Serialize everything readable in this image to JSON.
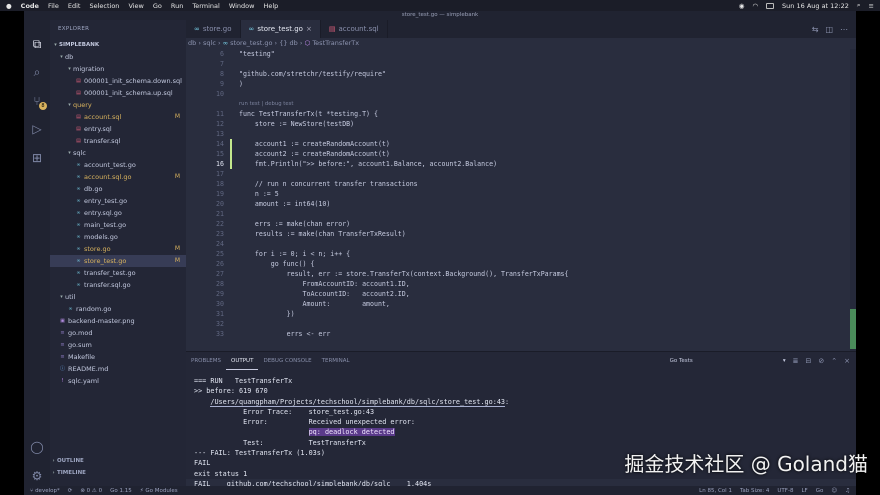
{
  "menubar": {
    "app": "Code",
    "items": [
      "File",
      "Edit",
      "Selection",
      "View",
      "Go",
      "Run",
      "Terminal",
      "Window",
      "Help"
    ],
    "clock": "Sun 16 Aug at 12:22"
  },
  "window": {
    "title": "store_test.go — simplebank"
  },
  "sidebar": {
    "header": "EXPLORER",
    "project": "SIMPLEBANK",
    "tree": [
      {
        "label": "db",
        "kind": "folder",
        "depth": 0,
        "open": true
      },
      {
        "label": "migration",
        "kind": "folder",
        "depth": 1,
        "open": true
      },
      {
        "label": "000001_init_schema.down.sql",
        "kind": "sql",
        "depth": 2
      },
      {
        "label": "000001_init_schema.up.sql",
        "kind": "sql",
        "depth": 2
      },
      {
        "label": "query",
        "kind": "folder",
        "depth": 1,
        "open": true,
        "mod": true
      },
      {
        "label": "account.sql",
        "kind": "sql",
        "depth": 2,
        "mod": true,
        "badge": "M"
      },
      {
        "label": "entry.sql",
        "kind": "sql",
        "depth": 2
      },
      {
        "label": "transfer.sql",
        "kind": "sql",
        "depth": 2
      },
      {
        "label": "sqlc",
        "kind": "folder",
        "depth": 1,
        "open": true
      },
      {
        "label": "account_test.go",
        "kind": "go",
        "depth": 2
      },
      {
        "label": "account.sql.go",
        "kind": "go",
        "depth": 2,
        "mod": true,
        "badge": "M"
      },
      {
        "label": "db.go",
        "kind": "go",
        "depth": 2
      },
      {
        "label": "entry_test.go",
        "kind": "go",
        "depth": 2
      },
      {
        "label": "entry.sql.go",
        "kind": "go",
        "depth": 2
      },
      {
        "label": "main_test.go",
        "kind": "go",
        "depth": 2
      },
      {
        "label": "models.go",
        "kind": "go",
        "depth": 2
      },
      {
        "label": "store.go",
        "kind": "go",
        "depth": 2,
        "mod": true,
        "badge": "M"
      },
      {
        "label": "store_test.go",
        "kind": "go",
        "depth": 2,
        "mod": true,
        "badge": "M",
        "selected": true
      },
      {
        "label": "transfer_test.go",
        "kind": "go",
        "depth": 2
      },
      {
        "label": "transfer.sql.go",
        "kind": "go",
        "depth": 2
      },
      {
        "label": "util",
        "kind": "folder",
        "depth": 0,
        "open": true
      },
      {
        "label": "random.go",
        "kind": "go",
        "depth": 1
      },
      {
        "label": "backend-master.png",
        "kind": "img",
        "depth": 0
      },
      {
        "label": "go.mod",
        "kind": "mod",
        "depth": 0
      },
      {
        "label": "go.sum",
        "kind": "mod",
        "depth": 0
      },
      {
        "label": "Makefile",
        "kind": "mod",
        "depth": 0
      },
      {
        "label": "README.md",
        "kind": "md",
        "depth": 0
      },
      {
        "label": "sqlc.yaml",
        "kind": "yml",
        "depth": 0
      }
    ],
    "outline": "OUTLINE",
    "timeline": "TIMELINE"
  },
  "icons": [
    "files-icon",
    "search-icon",
    "source-control-icon",
    "run-debug-icon",
    "extensions-icon",
    "account-icon",
    "settings-icon"
  ],
  "scm_badge": "8",
  "editor": {
    "tabs": [
      {
        "label": "store.go",
        "active": false
      },
      {
        "label": "store_test.go",
        "active": true
      },
      {
        "label": "account.sql",
        "active": false
      }
    ],
    "breadcrumb": [
      "db",
      "sqlc",
      "store_test.go",
      "{} db",
      "TestTransferTx"
    ],
    "lines": [
      {
        "n": "6",
        "t": "\"testing\""
      },
      {
        "n": "7",
        "t": ""
      },
      {
        "n": "8",
        "t": "\"github.com/stretchr/testify/require\""
      },
      {
        "n": "9",
        "t": ")"
      },
      {
        "n": "10",
        "t": ""
      },
      {
        "n": "",
        "t": "run test | debug test",
        "lens": true
      },
      {
        "n": "11",
        "t": "func TestTransferTx(t *testing.T) {"
      },
      {
        "n": "12",
        "t": "    store := NewStore(testDB)"
      },
      {
        "n": "13",
        "t": ""
      },
      {
        "n": "14",
        "t": "    account1 := createRandomAccount(t)",
        "g": true
      },
      {
        "n": "15",
        "t": "    account2 := createRandomAccount(t)",
        "g": true
      },
      {
        "n": "16",
        "t": "    fmt.Println(\">> before:\", account1.Balance, account2.Balance)",
        "g": true,
        "cur": true
      },
      {
        "n": "17",
        "t": ""
      },
      {
        "n": "18",
        "t": "    // run n concurrent transfer transactions"
      },
      {
        "n": "19",
        "t": "    n := 5"
      },
      {
        "n": "20",
        "t": "    amount := int64(10)"
      },
      {
        "n": "21",
        "t": ""
      },
      {
        "n": "22",
        "t": "    errs := make(chan error)"
      },
      {
        "n": "23",
        "t": "    results := make(chan TransferTxResult)"
      },
      {
        "n": "24",
        "t": ""
      },
      {
        "n": "25",
        "t": "    for i := 0; i < n; i++ {"
      },
      {
        "n": "26",
        "t": "        go func() {"
      },
      {
        "n": "27",
        "t": "            result, err := store.TransferTx(context.Background(), TransferTxParams{"
      },
      {
        "n": "28",
        "t": "                FromAccountID: account1.ID,"
      },
      {
        "n": "29",
        "t": "                ToAccountID:   account2.ID,"
      },
      {
        "n": "30",
        "t": "                Amount:        amount,"
      },
      {
        "n": "31",
        "t": "            })"
      },
      {
        "n": "32",
        "t": ""
      },
      {
        "n": "33",
        "t": "            errs <- err"
      }
    ]
  },
  "panel": {
    "tabs": [
      "PROBLEMS",
      "OUTPUT",
      "DEBUG CONSOLE",
      "TERMINAL"
    ],
    "active_tab": "OUTPUT",
    "channel": "Go Tests",
    "output": [
      {
        "pre": "=== RUN   TestTransferTx"
      },
      {
        "pre": ">> before: 619 670"
      },
      {
        "pre": "    ",
        "ul": "/Users/quangpham/Projects/techschool/simplebank/db/sqlc/store_test.go:43",
        "post": ":"
      },
      {
        "pre": "            Error Trace:    store_test.go:43"
      },
      {
        "pre": "            Error:          Received unexpected error:"
      },
      {
        "pre": "                            ",
        "hl": "pq: deadlock detected",
        "post": ""
      },
      {
        "pre": "            Test:           TestTransferTx"
      },
      {
        "pre": "--- FAIL: TestTransferTx (1.03s)"
      },
      {
        "pre": "FAIL"
      },
      {
        "pre": "exit status 1"
      },
      {
        "pre": "FAIL    github.com/techschool/simplebank/db/sqlc    1.404s"
      }
    ]
  },
  "status": {
    "branch": "develop*",
    "sync": "⟳",
    "errors": "⊗ 0 ⚠ 0",
    "go_version": "Go 1.15",
    "modules": "Go Modules",
    "position": "Ln 85, Col 1",
    "tabsize": "Tab Size: 4",
    "encoding": "UTF-8",
    "eol": "LF",
    "language": "Go"
  },
  "watermark": "掘金技术社区 @ Goland猫"
}
